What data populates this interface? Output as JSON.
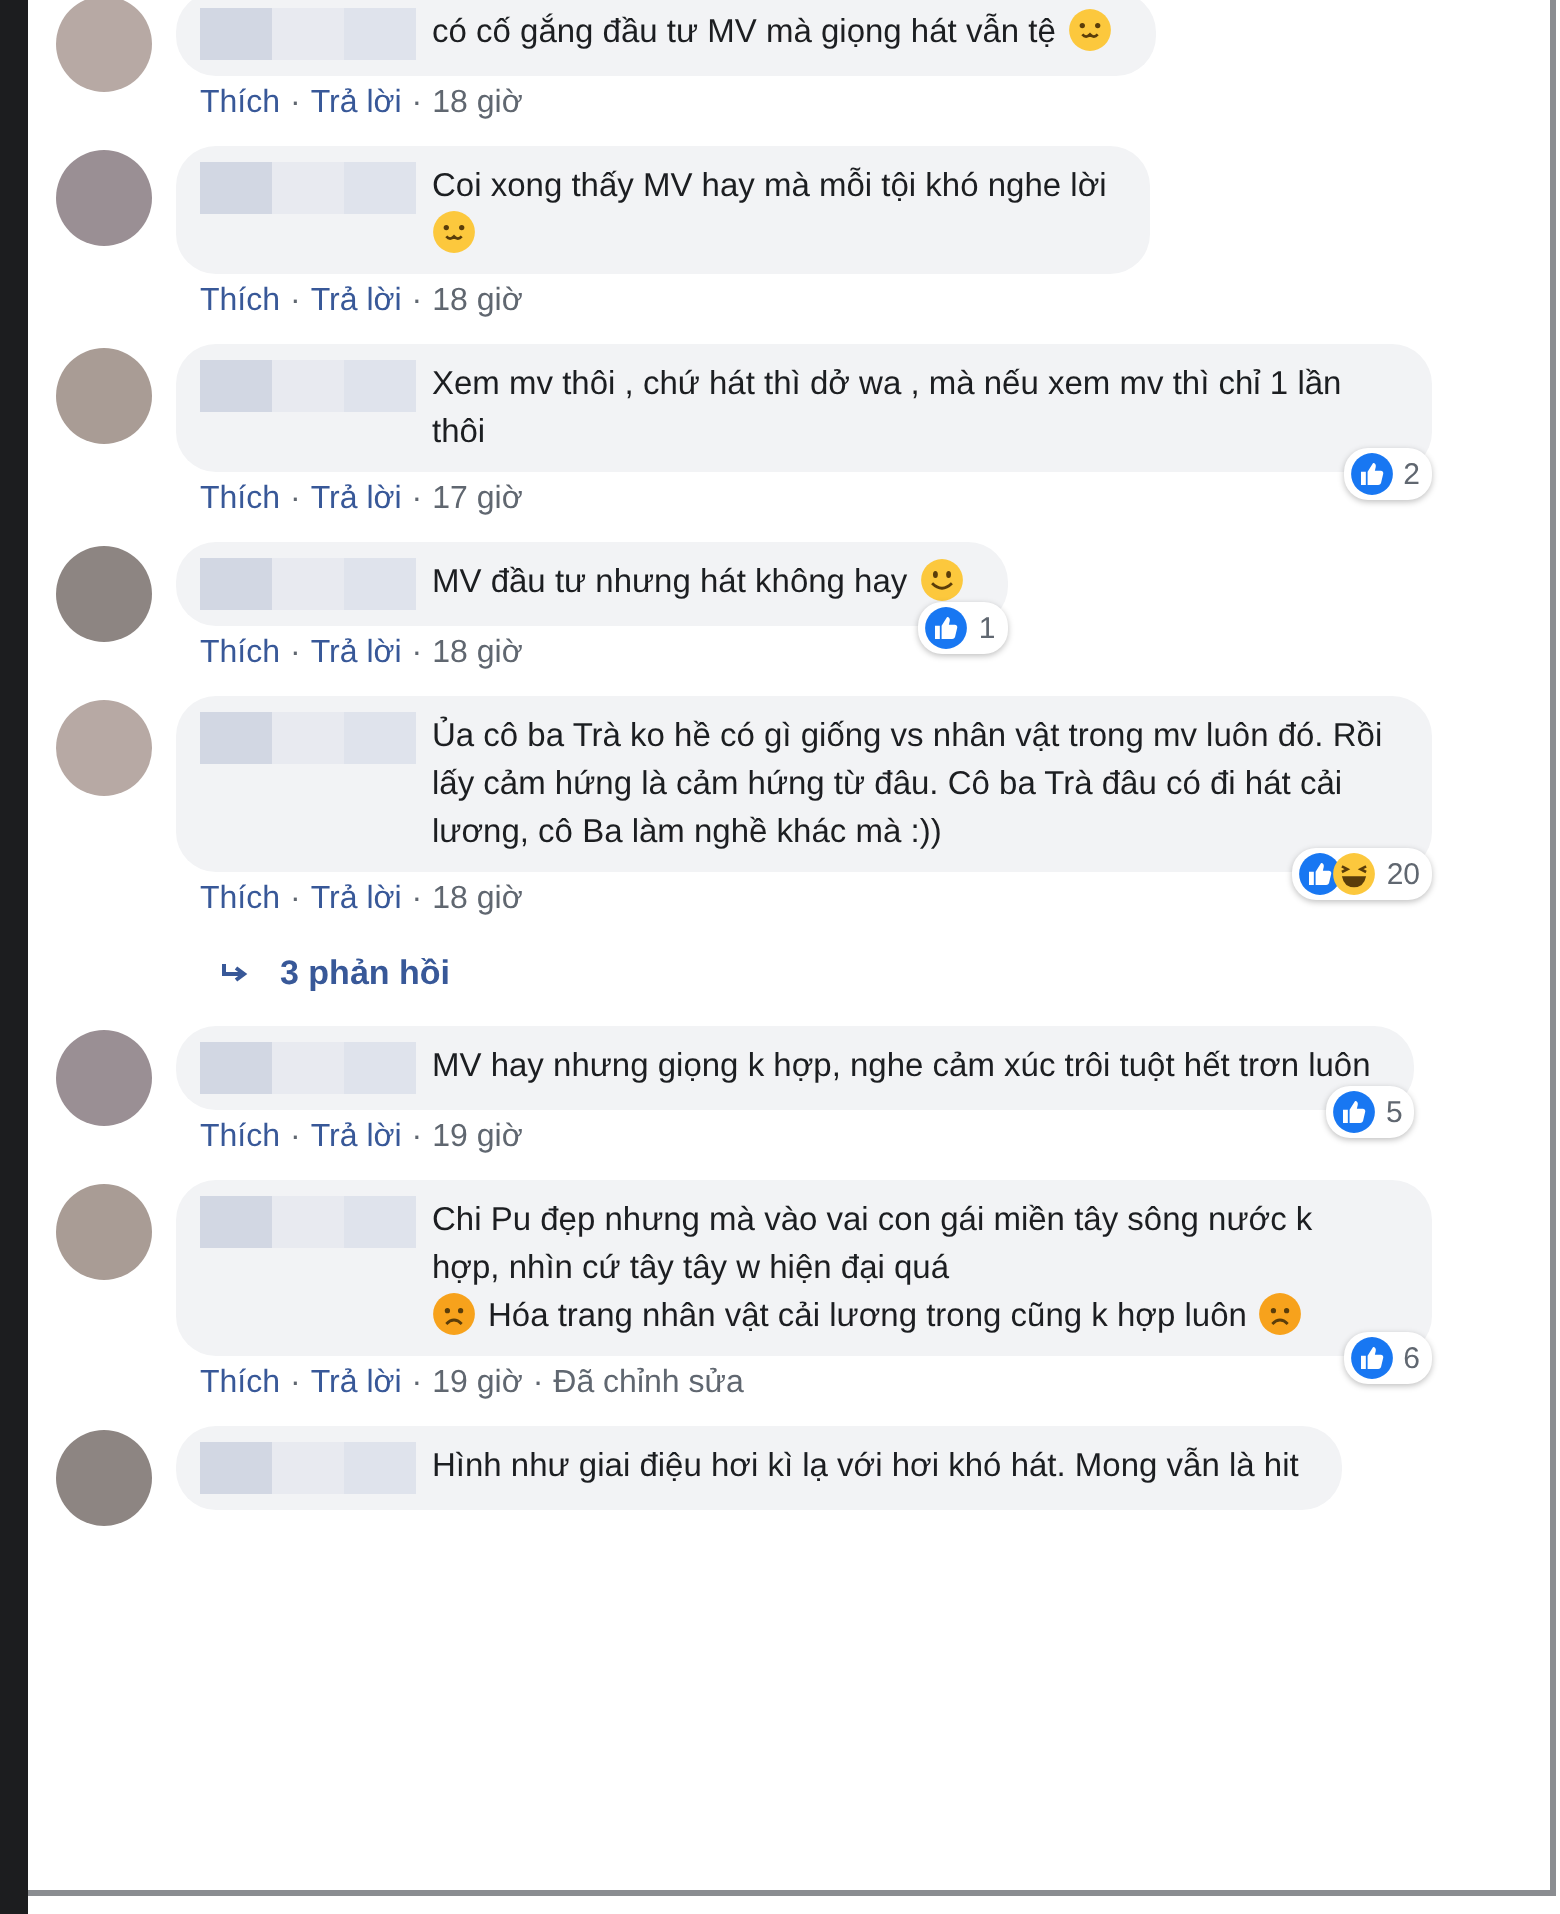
{
  "comments": [
    {
      "segments": [
        {
          "kind": "text",
          "text": "có cố gắng đầu tư MV mà giọng hát vẫn tệ"
        },
        {
          "kind": "cute"
        }
      ],
      "meta": [
        {
          "kind": "link",
          "text": "Thích"
        },
        {
          "kind": "sep",
          "text": "·"
        },
        {
          "kind": "link",
          "text": "Trả lời"
        },
        {
          "kind": "sep",
          "text": "·"
        },
        {
          "kind": "time",
          "text": "18 giờ"
        }
      ]
    },
    {
      "segments": [
        {
          "kind": "text",
          "text": "Coi xong thấy MV hay mà mỗi tội khó nghe lời"
        },
        {
          "kind": "break"
        },
        {
          "kind": "cute"
        }
      ],
      "meta": [
        {
          "kind": "link",
          "text": "Thích"
        },
        {
          "kind": "sep",
          "text": "·"
        },
        {
          "kind": "link",
          "text": "Trả lời"
        },
        {
          "kind": "sep",
          "text": "·"
        },
        {
          "kind": "time",
          "text": "18 giờ"
        }
      ]
    },
    {
      "segments": [
        {
          "kind": "text",
          "text": "Xem mv thôi , chứ hát thì dở wa , mà nếu xem mv thì chỉ 1 lần thôi"
        }
      ],
      "meta": [
        {
          "kind": "link",
          "text": "Thích"
        },
        {
          "kind": "sep",
          "text": "·"
        },
        {
          "kind": "link",
          "text": "Trả lời"
        },
        {
          "kind": "sep",
          "text": "·"
        },
        {
          "kind": "time",
          "text": "17 giờ"
        }
      ],
      "reactions": {
        "icons": [
          {
            "kind": "like"
          }
        ],
        "count": "2"
      }
    },
    {
      "segments": [
        {
          "kind": "text",
          "text": "MV đầu tư nhưng hát không hay"
        },
        {
          "kind": "smile"
        }
      ],
      "meta": [
        {
          "kind": "link",
          "text": "Thích"
        },
        {
          "kind": "sep",
          "text": "·"
        },
        {
          "kind": "link",
          "text": "Trả lời"
        },
        {
          "kind": "sep",
          "text": "·"
        },
        {
          "kind": "time",
          "text": "18 giờ"
        }
      ],
      "reactions": {
        "icons": [
          {
            "kind": "like"
          }
        ],
        "count": "1"
      }
    },
    {
      "segments": [
        {
          "kind": "text",
          "text": "Ủa cô ba Trà ko hề có gì giống vs nhân vật trong mv luôn đó. Rồi lấy cảm hứng là cảm hứng từ đâu. Cô ba Trà đâu có đi hát cải lương, cô Ba làm nghề khác mà :))"
        }
      ],
      "meta": [
        {
          "kind": "link",
          "text": "Thích"
        },
        {
          "kind": "sep",
          "text": "·"
        },
        {
          "kind": "link",
          "text": "Trả lời"
        },
        {
          "kind": "sep",
          "text": "·"
        },
        {
          "kind": "time",
          "text": "18 giờ"
        }
      ],
      "reactions": {
        "icons": [
          {
            "kind": "like"
          },
          {
            "kind": "haha"
          }
        ],
        "count": "20"
      },
      "replies": "3 phản hồi"
    },
    {
      "segments": [
        {
          "kind": "text",
          "text": "MV hay nhưng giọng k hợp, nghe cảm xúc trôi tuột hết trơn luôn"
        }
      ],
      "meta": [
        {
          "kind": "link",
          "text": "Thích"
        },
        {
          "kind": "sep",
          "text": "·"
        },
        {
          "kind": "link",
          "text": "Trả lời"
        },
        {
          "kind": "sep",
          "text": "·"
        },
        {
          "kind": "time",
          "text": "19 giờ"
        }
      ],
      "reactions": {
        "icons": [
          {
            "kind": "like"
          }
        ],
        "count": "5"
      }
    },
    {
      "segments": [
        {
          "kind": "text",
          "text": "Chi Pu đẹp nhưng mà vào vai con gái miền tây sông nước k hợp, nhìn cứ tây tây w hiện đại quá"
        },
        {
          "kind": "frown"
        },
        {
          "kind": "text",
          "text": "Hóa trang nhân vật cải lương trong cũng k hợp luôn"
        },
        {
          "kind": "frown"
        }
      ],
      "meta": [
        {
          "kind": "link",
          "text": "Thích"
        },
        {
          "kind": "sep",
          "text": "·"
        },
        {
          "kind": "link",
          "text": "Trả lời"
        },
        {
          "kind": "sep",
          "text": "·"
        },
        {
          "kind": "time",
          "text": "19 giờ"
        },
        {
          "kind": "sep",
          "text": "·"
        },
        {
          "kind": "time",
          "text": "Đã chỉnh sửa"
        }
      ],
      "reactions": {
        "icons": [
          {
            "kind": "like"
          }
        ],
        "count": "6"
      }
    },
    {
      "segments": [
        {
          "kind": "text",
          "text": "Hình như giai điệu hơi kì lạ với hơi khó hát. Mong vẫn là hit"
        }
      ]
    }
  ]
}
